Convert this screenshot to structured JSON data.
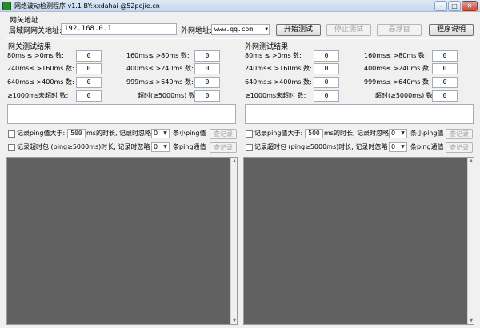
{
  "window": {
    "title": "网络波动检测程序 v1.1  BY:xxdahai  @52pojie.cn"
  },
  "gateway": {
    "group_title": "网关地址",
    "lan_label": "局域网网关地址:",
    "lan_value": "192.168.0.1",
    "wan_label": "外网地址:",
    "wan_value": "www.qq.com"
  },
  "buttons": {
    "start": "开始测试",
    "stop": "停止测试",
    "float": "悬浮窗",
    "about": "程序说明"
  },
  "lan_results": {
    "title": "网关测试结果",
    "rows": [
      {
        "label": "80ms ≤ >0ms  数:",
        "value": "0"
      },
      {
        "label": "160ms≤ >80ms  数:",
        "value": "0"
      },
      {
        "label": "240ms≤ >160ms 数:",
        "value": "0"
      },
      {
        "label": "400ms≤ >240ms 数:",
        "value": "0"
      },
      {
        "label": "640ms≤ >400ms 数:",
        "value": "0"
      },
      {
        "label": "999ms≤ >640ms 数:",
        "value": "0"
      },
      {
        "label": "≥1000ms未超时 数:",
        "value": "0"
      },
      {
        "label": "超时(≥5000ms) 数:",
        "value": "0"
      }
    ]
  },
  "wan_results": {
    "title": "外网测试结果",
    "rows": [
      {
        "label": "80ms ≤ >0ms  数:",
        "value": "0"
      },
      {
        "label": "160ms≤ >80ms  数:",
        "value": "0"
      },
      {
        "label": "240ms≤ >160ms 数:",
        "value": "0"
      },
      {
        "label": "400ms≤ >240ms 数:",
        "value": "0"
      },
      {
        "label": "640ms≤ >400ms 数:",
        "value": "0"
      },
      {
        "label": "999ms≤ >640ms 数:",
        "value": "0"
      },
      {
        "label": "≥1000ms未超时 数:",
        "value": "0"
      },
      {
        "label": "超时(≥5000ms) 数:",
        "value": "0"
      }
    ]
  },
  "record_options": {
    "ping_over_prefix": "记录ping值大于:",
    "ping_over_value": "500",
    "ping_over_suffix": "ms的时长, 记录时忽略",
    "ignore_value_1": "0",
    "ping_over_tail": "条小ping值",
    "timeout_prefix": "记录超时包  (ping≥5000ms)时长, 记录时忽略",
    "ignore_value_2": "0",
    "timeout_tail": "条ping通值",
    "view_record": "查记录"
  },
  "colors": {
    "panel_bg": "#616161",
    "window_bg": "#f0f0f0"
  }
}
